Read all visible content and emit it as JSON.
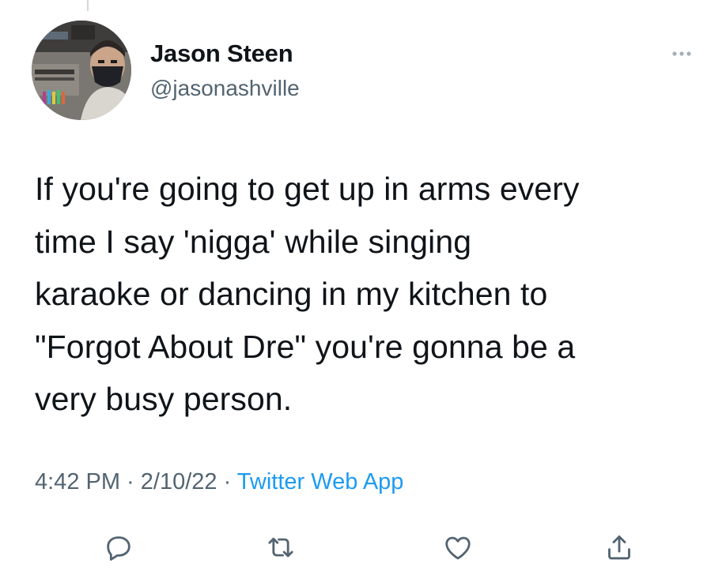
{
  "tweet": {
    "user": {
      "display_name": "Jason Steen",
      "handle": "@jasonashville",
      "avatar": "avatar-photo"
    },
    "text_lines": [
      "If you're going to get up in arms every",
      "time I say 'nigga' while singing",
      "karaoke or dancing in my kitchen to",
      "\"Forgot About Dre\" you're gonna be a",
      "very busy person."
    ],
    "meta": {
      "time": "4:42 PM",
      "separator": " · ",
      "date": "2/10/22",
      "source": "Twitter Web App"
    },
    "icons": {
      "more": "more-dots-icon",
      "reply": "reply-icon",
      "retweet": "retweet-icon",
      "like": "like-icon",
      "share": "share-icon"
    },
    "colors": {
      "text": "#0f1419",
      "secondary": "#536471",
      "link": "#1d9bf0",
      "icon": "#536471"
    }
  }
}
